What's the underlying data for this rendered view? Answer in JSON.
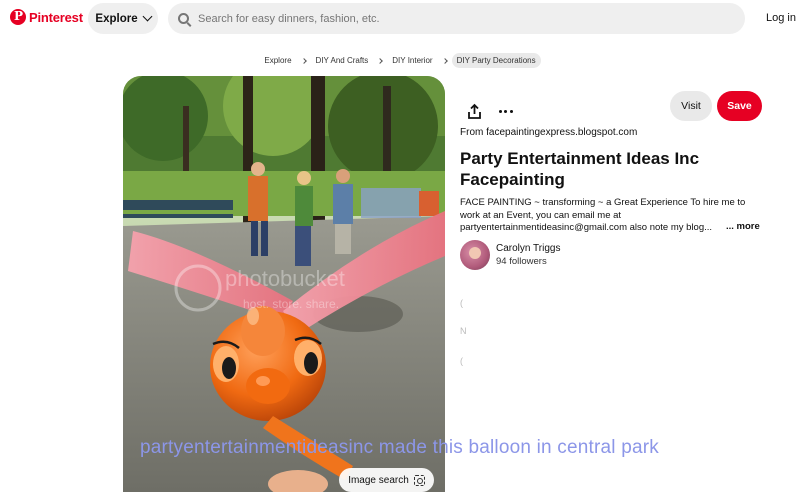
{
  "header": {
    "logo_text": "Pinterest",
    "explore_label": "Explore",
    "search_placeholder": "Search for easy dinners, fashion, etc.",
    "login_label": "Log in"
  },
  "breadcrumb": [
    "Explore",
    "DIY And Crafts",
    "DIY Interior",
    "DIY Party Decorations"
  ],
  "pin": {
    "image_search_label": "Image search",
    "caption": "partyentertainmentideasinc made this balloon in central park",
    "watermark_line1": "photobucket",
    "watermark_line2": "host. store. share."
  },
  "details": {
    "visit_label": "Visit",
    "save_label": "Save",
    "source_prefix": "From",
    "source_domain": "facepaintingexpress.blogspot.com",
    "title": "Party Entertainment Ideas Inc Facepainting",
    "description": "FACE PAINTING ~ transforming ~ a Great Experience To hire me to work at an Event, you can email me at partyentertainmentideasinc@gmail.com also note my blog...",
    "more_label": "... more",
    "creator_name": "Carolyn Triggs",
    "followers": "94 followers",
    "faint_letter": "N"
  },
  "colors": {
    "brand": "#e60023",
    "caption": "#8c96e8"
  }
}
